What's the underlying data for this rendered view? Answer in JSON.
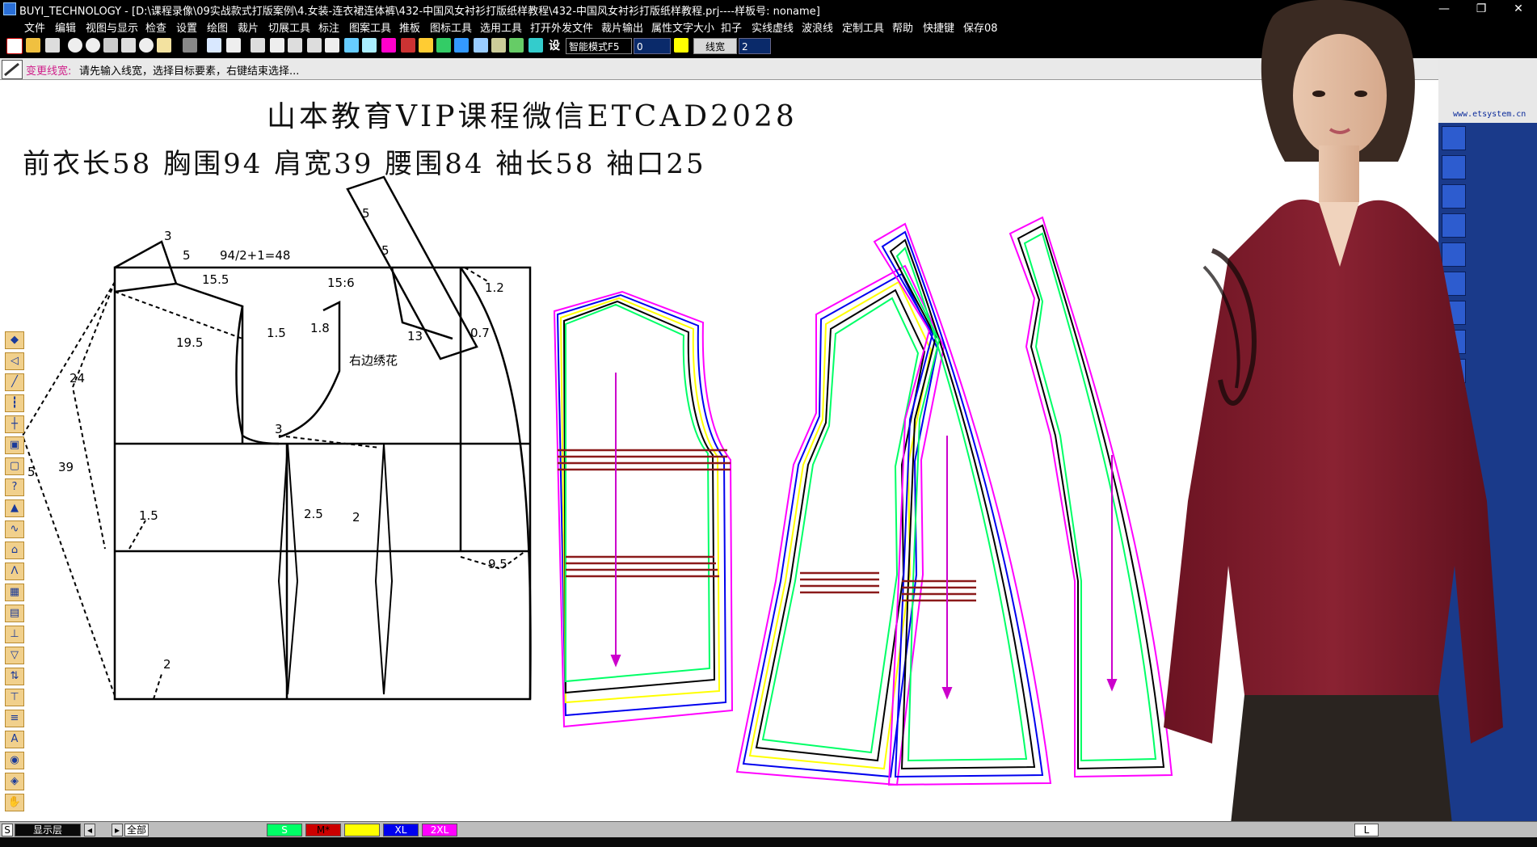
{
  "window": {
    "title": "BUYI_TECHNOLOGY - [D:\\课程录像\\09实战款式打版案例\\4.女装-连衣裙连体裤\\432-中国风女衬衫打版纸样教程\\432-中国风女衬衫打版纸样教程.prj----样板号: noname]",
    "minimize": "—",
    "maximize": "❐",
    "close": "✕"
  },
  "menu": [
    "文件",
    "编辑",
    "视图与显示",
    "检查",
    "设置",
    "绘图",
    "裁片",
    "切展工具",
    "标注",
    "图案工具",
    "推板",
    "图标工具",
    "选用工具",
    "打开外发文件",
    "裁片输出",
    "属性文字大小",
    "扣子",
    "实线虚线",
    "波浪线",
    "定制工具",
    "帮助",
    "快捷键",
    "保存08"
  ],
  "toolbar": {
    "setting_label": "设",
    "mode_select": "智能模式F5",
    "value_field": "0",
    "linewidth_label": "线宽",
    "linewidth_value": "2"
  },
  "status": {
    "command": "变更线宽:",
    "prompt": "请先输入线宽，选择目标要素，右键结束选择..."
  },
  "heading": {
    "line1": "山本教育VIP课程微信ETCAD2028",
    "line2": "前衣长58   胸围94   肩宽39   腰围84   袖长58   袖口25"
  },
  "annotations": {
    "a3": "3",
    "a5": "5",
    "chest_formula": "94/2+1=48",
    "a15_5": "15.5",
    "a15_6": "15:6",
    "a1_2": "1.2",
    "a19_5": "19.5",
    "a1_5": "1.5",
    "a1_8": "1.8",
    "embroidery": "右边绣花",
    "a13": "13",
    "a0_7": "0.7",
    "a24": "24",
    "a3b": "3",
    "a39": "39",
    "a5_left": "5",
    "a1_5b": "1.5",
    "a2_5": "2.5",
    "a2": "2",
    "a9_5": "9.5",
    "a2b": "2",
    "a5_top": "5",
    "a5_side": "5"
  },
  "website": "www.etsystem.cn",
  "bottom": {
    "s_label": "S",
    "layer_label": "显示层",
    "all_label": "全部",
    "sizes": [
      {
        "name": "S",
        "color": "#00ff66"
      },
      {
        "name": "M*",
        "color": "#cc0000"
      },
      {
        "name": "",
        "color": "#ffff00"
      },
      {
        "name": "XL",
        "color": "#0000ee"
      },
      {
        "name": "2XL",
        "color": "#ff00ff"
      }
    ],
    "right_label": "L"
  },
  "colors": {
    "size_s": "#00ff66",
    "size_m": "#000000",
    "size_l": "#ffff00",
    "size_xl": "#0000ee",
    "size_2xl": "#ff00ff",
    "darkred": "#8b1a1a",
    "blouse": "#7a1c2a"
  }
}
